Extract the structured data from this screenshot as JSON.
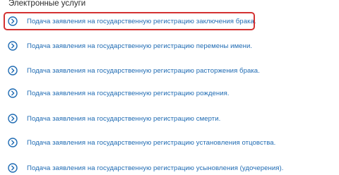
{
  "section": {
    "title": "Электронные услуги"
  },
  "services": [
    {
      "label": "Подача заявления на государственную регистрацию заключения брака.",
      "highlighted": true
    },
    {
      "label": "Подача заявления на государственную регистрацию перемены имени.",
      "highlighted": false
    },
    {
      "label": "Подача заявления на государственную регистрацию расторжения брака.",
      "highlighted": false
    },
    {
      "label": "Подача заявления на государственную регистрацию рождения.",
      "highlighted": false
    },
    {
      "label": "Подача заявления на государственную регистрацию смерти.",
      "highlighted": false
    },
    {
      "label": "Подача заявления на государственную регистрацию установления отцовства.",
      "highlighted": false
    },
    {
      "label": "Подача заявления на государственную регистрацию усыновления (удочерения).",
      "highlighted": false
    }
  ],
  "colors": {
    "link": "#1f6bb3",
    "icon": "#1f6bb3",
    "highlight_border": "#d43232",
    "title_text": "#2b2b2b"
  },
  "icons": {
    "service": "chevron-right-circle-icon"
  }
}
